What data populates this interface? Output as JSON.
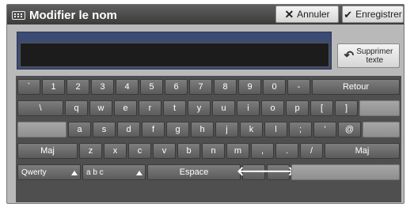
{
  "header": {
    "title": "Modifier le nom",
    "cancel_label": "Annuler",
    "save_label": "Enregistrer"
  },
  "input": {
    "value": "",
    "placeholder": ""
  },
  "delete_text": {
    "line1": "Supprimer",
    "line2": "texte"
  },
  "keys": {
    "row1": [
      "`",
      "1",
      "2",
      "3",
      "4",
      "5",
      "6",
      "7",
      "8",
      "9",
      "0",
      "-"
    ],
    "retour": "Retour",
    "row2": [
      "\\",
      "q",
      "w",
      "e",
      "r",
      "t",
      "y",
      "u",
      "i",
      "o",
      "p",
      "[",
      "]"
    ],
    "row3": [
      "a",
      "s",
      "d",
      "f",
      "g",
      "h",
      "j",
      "k",
      "l",
      ";",
      "'",
      "@"
    ],
    "maj": "Maj",
    "row4": [
      "z",
      "x",
      "c",
      "v",
      "b",
      "n",
      "m",
      ",",
      ".",
      "/"
    ],
    "qwerty": "Qwerty",
    "abc": "a b c",
    "space": "Espace",
    "left_arrow": "🡐",
    "right_arrow": "🡒"
  },
  "icons": {
    "keyboard": "keyboard-icon",
    "cancel": "close-icon",
    "save": "check-icon",
    "undo": "undo-icon"
  }
}
